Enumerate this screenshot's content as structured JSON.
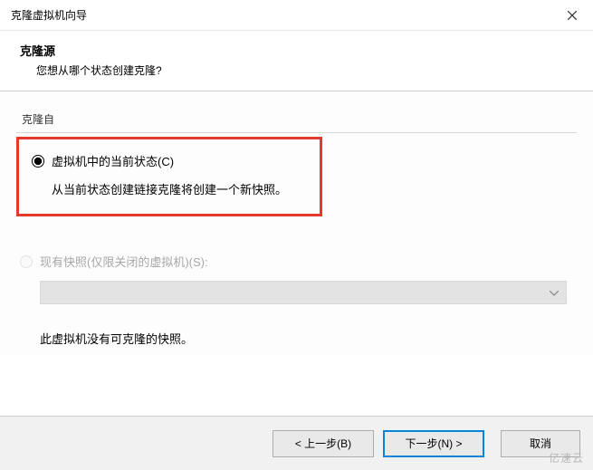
{
  "titlebar": {
    "title": "克隆虚拟机向导"
  },
  "header": {
    "title": "克隆源",
    "subtitle": "您想从哪个状态创建克隆?"
  },
  "clone_from": {
    "legend": "克隆自",
    "option_current": {
      "label": "虚拟机中的当前状态(C)",
      "desc": "从当前状态创建链接克隆将创建一个新快照。",
      "selected": true
    },
    "option_snapshot": {
      "label": "现有快照(仅限关闭的虚拟机)(S):",
      "enabled": false,
      "no_snapshots_msg": "此虚拟机没有可克隆的快照。"
    }
  },
  "footer": {
    "back": "< 上一步(B)",
    "next": "下一步(N) >",
    "cancel": "取消"
  },
  "watermark": "亿速云"
}
